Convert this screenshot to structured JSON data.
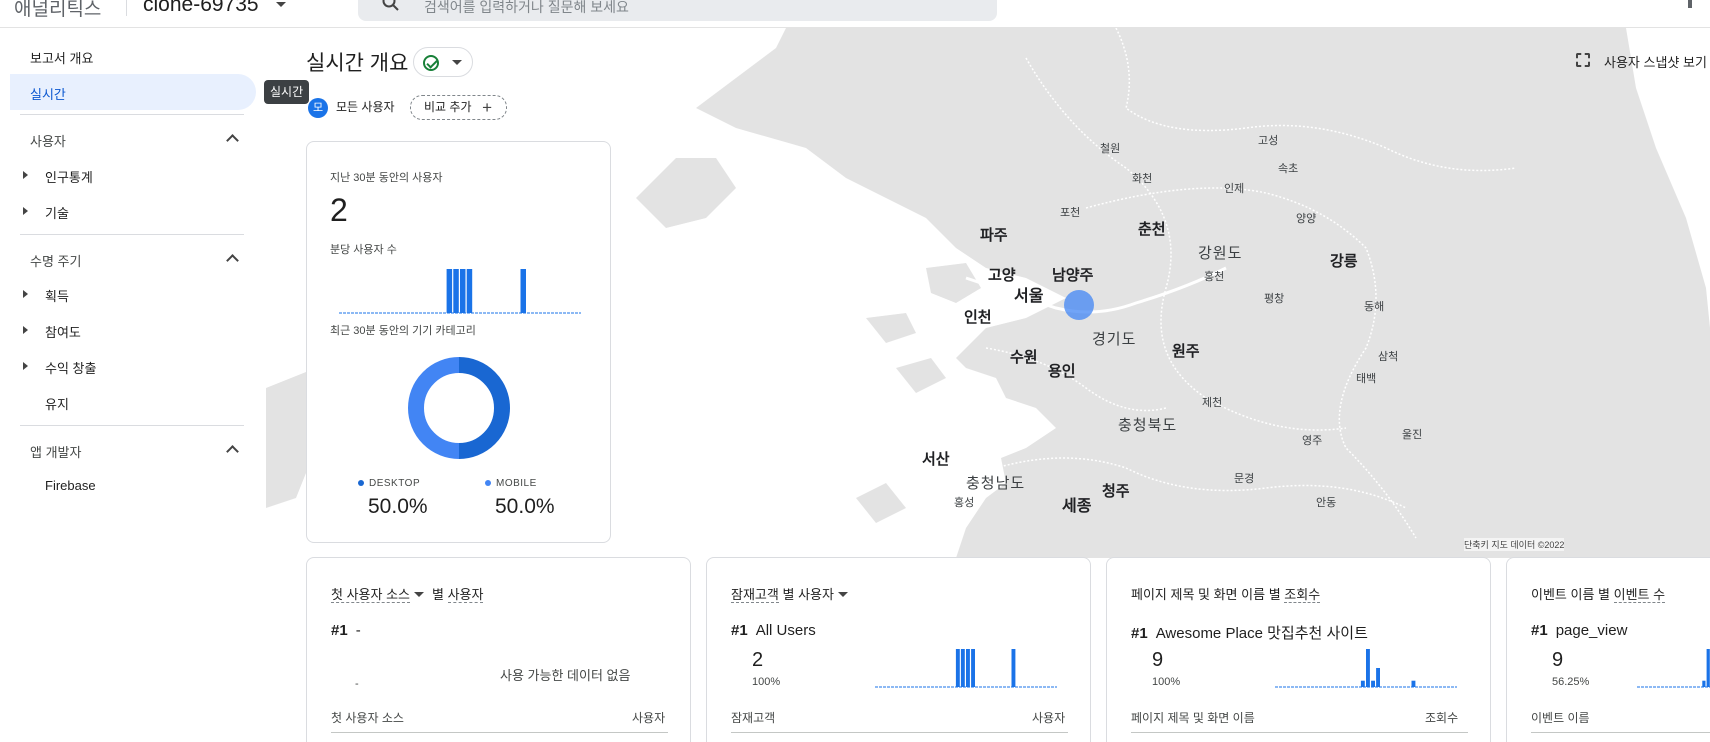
{
  "topbar": {
    "app_name": "애널리틱스",
    "property": "clone-69735",
    "search_placeholder": "검색어를 입력하거나 질문해 보세요"
  },
  "sidebar": {
    "overview": "보고서 개요",
    "realtime": "실시간",
    "tooltip": "실시간",
    "sections": [
      {
        "title": "사용자",
        "items": [
          {
            "label": "인구통계",
            "expandable": true
          },
          {
            "label": "기술",
            "expandable": true
          }
        ]
      },
      {
        "title": "수명 주기",
        "items": [
          {
            "label": "획득",
            "expandable": true
          },
          {
            "label": "참여도",
            "expandable": true
          },
          {
            "label": "수익 창출",
            "expandable": true
          },
          {
            "label": "유지",
            "expandable": false
          }
        ]
      },
      {
        "title": "앱 개발자",
        "items": [
          {
            "label": "Firebase",
            "expandable": false
          }
        ]
      }
    ]
  },
  "header": {
    "title": "실시간 개요",
    "snapshot": "사용자 스냅샷 보기",
    "segment_chip": {
      "avatar": "모",
      "label": "모든 사용자"
    },
    "add_comparison": "비교 추가"
  },
  "users_card": {
    "label_users": "지난 30분 동안의 사용자",
    "users_value": "2",
    "label_per_minute": "분당 사용자 수",
    "per_minute_series": [
      0,
      0,
      0,
      0,
      0,
      0,
      0,
      0,
      0,
      0,
      0,
      0,
      0,
      0,
      0,
      0,
      1,
      1,
      1,
      1,
      0,
      0,
      0,
      0,
      0,
      0,
      0,
      1,
      0,
      0,
      0,
      0,
      0,
      0,
      0,
      0
    ],
    "label_device": "최근 30분 동안의 기기 카테고리",
    "devices": [
      {
        "name": "DESKTOP",
        "value": "50.0%",
        "share": 0.5,
        "color": "#1967d2"
      },
      {
        "name": "MOBILE",
        "value": "50.0%",
        "share": 0.5,
        "color": "#4285f4"
      }
    ]
  },
  "map": {
    "attribution": "단축키   지도 데이터 ©2022",
    "places": [
      {
        "name": "철원",
        "cls": ""
      },
      {
        "name": "고성",
        "cls": ""
      },
      {
        "name": "속초",
        "cls": ""
      },
      {
        "name": "화천",
        "cls": ""
      },
      {
        "name": "인제",
        "cls": ""
      },
      {
        "name": "양양",
        "cls": ""
      },
      {
        "name": "포천",
        "cls": ""
      },
      {
        "name": "파주",
        "cls": "big"
      },
      {
        "name": "춘천",
        "cls": "big"
      },
      {
        "name": "강원도",
        "cls": "prov"
      },
      {
        "name": "홍천",
        "cls": ""
      },
      {
        "name": "강릉",
        "cls": "big"
      },
      {
        "name": "고양",
        "cls": "big"
      },
      {
        "name": "남양주",
        "cls": "big"
      },
      {
        "name": "서울",
        "cls": "huge"
      },
      {
        "name": "평창",
        "cls": ""
      },
      {
        "name": "동해",
        "cls": ""
      },
      {
        "name": "인천",
        "cls": "big"
      },
      {
        "name": "경기도",
        "cls": "prov"
      },
      {
        "name": "원주",
        "cls": "big"
      },
      {
        "name": "삼척",
        "cls": ""
      },
      {
        "name": "수원",
        "cls": "big"
      },
      {
        "name": "용인",
        "cls": "big"
      },
      {
        "name": "태백",
        "cls": ""
      },
      {
        "name": "제천",
        "cls": ""
      },
      {
        "name": "충청북도",
        "cls": "prov"
      },
      {
        "name": "영주",
        "cls": ""
      },
      {
        "name": "울진",
        "cls": ""
      },
      {
        "name": "서산",
        "cls": "big"
      },
      {
        "name": "충청남도",
        "cls": "prov"
      },
      {
        "name": "문경",
        "cls": ""
      },
      {
        "name": "청주",
        "cls": "big"
      },
      {
        "name": "홍성",
        "cls": ""
      },
      {
        "name": "세종",
        "cls": "huge"
      },
      {
        "name": "안동",
        "cls": ""
      }
    ]
  },
  "cards": [
    {
      "title_dim": "첫 사용자 소스",
      "title_rest": "별",
      "title_metric": "사용자",
      "rank": "#1",
      "rank_name": "-",
      "value": "",
      "pct": "",
      "dash": "-",
      "nodata": "사용 가능한 데이터 없음",
      "col_left": "첫 사용자 소스",
      "col_right": "사용자",
      "series": []
    },
    {
      "title_dim": "잠재고객",
      "title_rest": "별",
      "title_metric": "사용자",
      "rank": "#1",
      "rank_name": "All Users",
      "value": "2",
      "pct": "100%",
      "col_left": "잠재고객",
      "col_right": "사용자",
      "series": [
        0,
        0,
        0,
        0,
        0,
        0,
        0,
        0,
        0,
        0,
        0,
        0,
        0,
        0,
        0,
        0,
        1,
        1,
        1,
        1,
        0,
        0,
        0,
        0,
        0,
        0,
        0,
        1,
        0,
        0,
        0,
        0,
        0,
        0,
        0,
        0
      ]
    },
    {
      "title_dim": "페이지 제목 및 화면 이름",
      "title_rest": "별",
      "title_metric": "조회수",
      "rank": "#1",
      "rank_name": "Awesome Place 맛집추천 사이트",
      "value": "9",
      "pct": "100%",
      "col_left": "페이지 제목 및 화면 이름",
      "col_right": "조회수",
      "series": [
        0,
        0,
        0,
        0,
        0,
        0,
        0,
        0,
        0,
        0,
        0,
        0,
        0,
        0,
        0,
        0,
        0,
        1,
        6,
        1,
        3,
        0,
        0,
        0,
        0,
        0,
        0,
        1,
        0,
        0,
        0,
        0,
        0,
        0,
        0,
        0
      ]
    },
    {
      "title_dim": "이벤트 이름",
      "title_rest": "별",
      "title_metric": "이벤트 수",
      "rank": "#1",
      "rank_name": "page_view",
      "value": "9",
      "pct": "56.25%",
      "col_left": "이벤트 이름",
      "col_right": "",
      "series": [
        0,
        0,
        0,
        0,
        0,
        0,
        0,
        0,
        0,
        0,
        0,
        0,
        0,
        0,
        0,
        1,
        6
      ]
    }
  ]
}
